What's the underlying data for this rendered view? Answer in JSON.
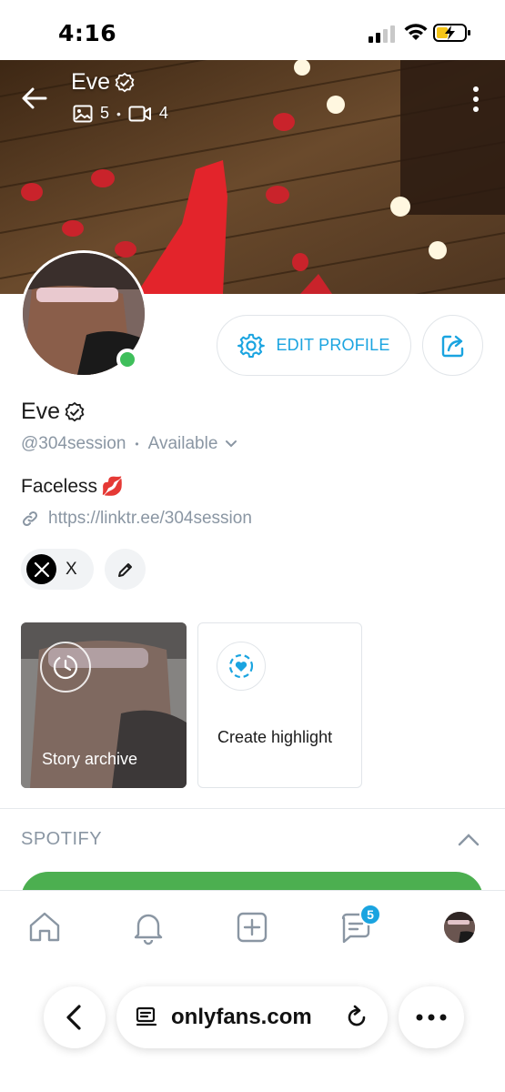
{
  "status_bar": {
    "time": "4:16"
  },
  "profile": {
    "name": "Eve",
    "photos_count": "5",
    "videos_count": "4",
    "handle": "@304session",
    "availability": "Available",
    "bio": "Faceless",
    "bio_emoji": "💋",
    "link": "https://linktr.ee/304session",
    "online": true
  },
  "actions": {
    "edit_profile_label": "EDIT PROFILE"
  },
  "socials": [
    {
      "label": "X",
      "icon": "x-logo-icon"
    }
  ],
  "highlights": {
    "story_archive_label": "Story archive",
    "create_highlight_label": "Create highlight"
  },
  "spotify": {
    "header": "SPOTIFY",
    "accent": "#4caf50"
  },
  "bottom_nav": {
    "items": [
      "home-icon",
      "bell-icon",
      "plus-square-icon",
      "messages-icon",
      "avatar"
    ],
    "messages_badge": "5"
  },
  "browser": {
    "url": "onlyfans.com"
  },
  "colors": {
    "accent": "#1aa4e0",
    "online": "#3fbf5b",
    "muted": "#8a96a3"
  }
}
